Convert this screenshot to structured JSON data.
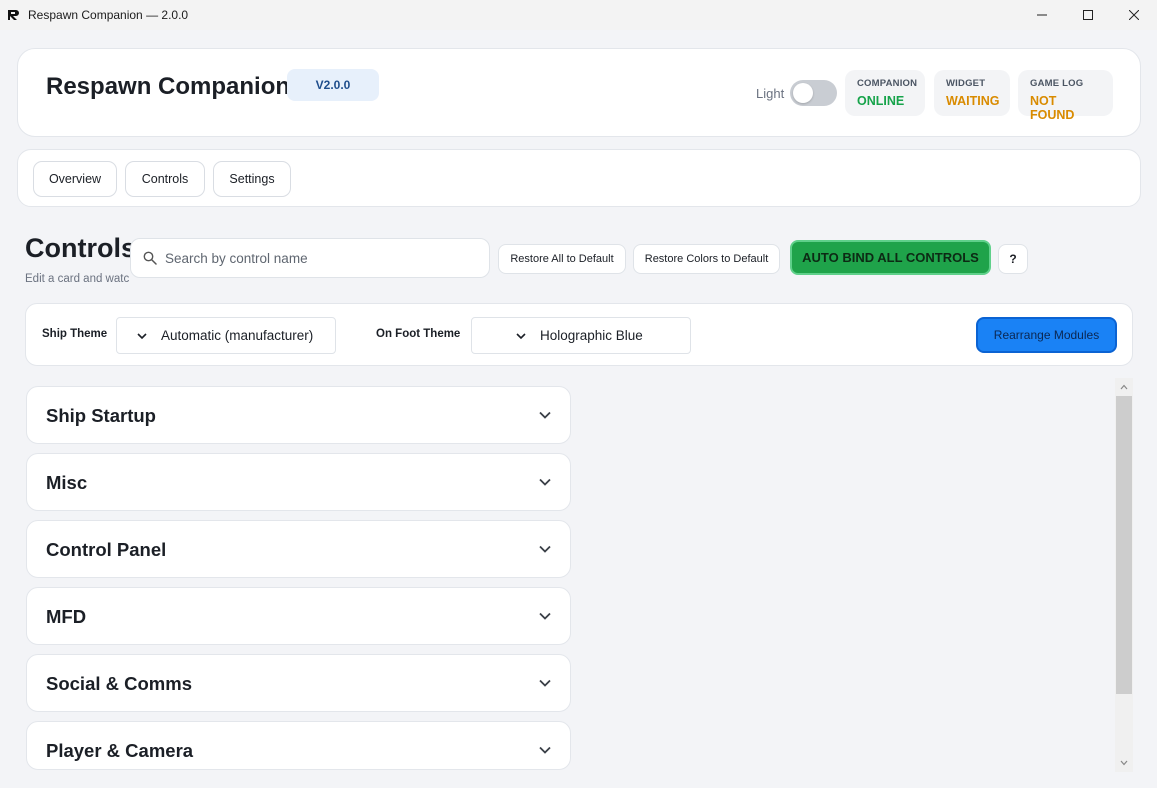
{
  "window": {
    "title": "Respawn Companion — 2.0.0"
  },
  "header": {
    "app_name": "Respawn Companion",
    "version": "V2.0.0",
    "theme_toggle_label": "Light",
    "statuses": [
      {
        "label": "COMPANION",
        "value": "ONLINE",
        "color": "#16a34a"
      },
      {
        "label": "WIDGET",
        "value": "WAITING",
        "color": "#d98b00"
      },
      {
        "label": "GAME LOG",
        "value": "NOT FOUND",
        "color": "#d98b00"
      }
    ]
  },
  "nav": {
    "tabs": [
      "Overview",
      "Controls",
      "Settings"
    ]
  },
  "controls": {
    "title": "Controls",
    "subtitle": "Edit a card and watc",
    "search_placeholder": "Search by control name",
    "restore_all_label": "Restore All to Default",
    "restore_colors_label": "Restore Colors to Default",
    "auto_bind_label": "AUTO BIND ALL CONTROLS",
    "help_label": "?"
  },
  "themes": {
    "ship_label": "Ship Theme",
    "ship_value": "Automatic (manufacturer)",
    "foot_label": "On Foot Theme",
    "foot_value": "Holographic Blue",
    "rearrange_label": "Rearrange Modules"
  },
  "modules": [
    "Ship Startup",
    "Misc",
    "Control Panel",
    "MFD",
    "Social & Comms",
    "Player & Camera"
  ],
  "colors": {
    "accent_green": "#1fa34a",
    "accent_blue": "#1a82f5",
    "status_ok": "#16a34a",
    "status_warn": "#d98b00"
  }
}
